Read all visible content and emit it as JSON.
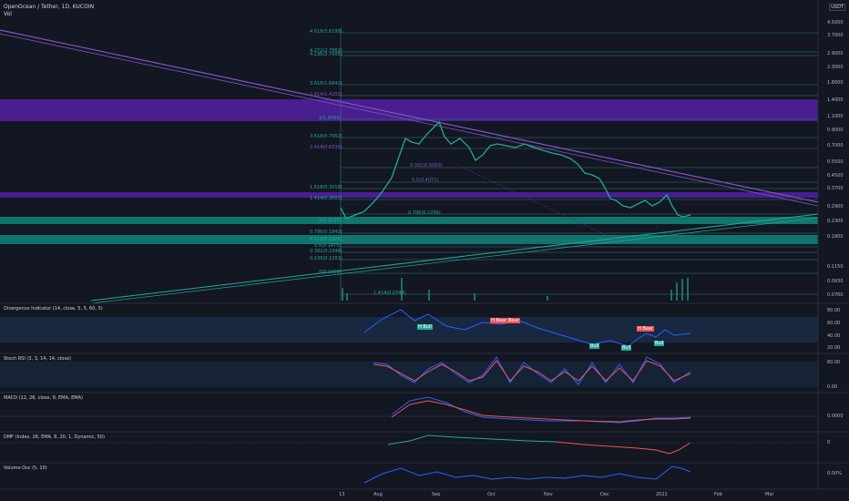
{
  "header": {
    "title": "OpenOcean / Tether, 1D, KUCOIN",
    "vol": "Vol",
    "currency": "USDT"
  },
  "price_axis": [
    "4.5000",
    "3.7000",
    "2.9000",
    "2.3000",
    "1.8000",
    "1.4000",
    "1.1000",
    "0.9000",
    "0.7000",
    "0.5500",
    "0.4500",
    "0.3700",
    "0.2900",
    "0.2300",
    "0.1800",
    "0.1150",
    "0.0930",
    "0.0760"
  ],
  "time_axis": [
    "13",
    "Aug",
    "Sep",
    "Oct",
    "Nov",
    "Dec",
    "2022",
    "Feb",
    "Mar"
  ],
  "fib_labels": [
    "4.618(3.6195)",
    "4.272(2.7862)",
    "4.236(2.7005)",
    "3.618(1.6642)",
    "2.414(1.4202)",
    "1(1.0096)",
    "3.618(0.7652)",
    "2.414(0.6530)",
    "0.382(0.5069)",
    "0.5(0.4071)",
    "1.618(0.3518)",
    "1.414(0.3002)",
    "0.786(0.2296)",
    "1(0.2135)",
    "0.786(0.1842)",
    "0.618(0.1666)",
    "0.5(0.1475)",
    "0.382(0.1348)",
    "0.236(0.1201)",
    "0(0.1039)",
    "1.414(0.0744)"
  ],
  "panels": {
    "divergence": {
      "title": "Divergence Indicator (14, close, 5, 5, 60, 5)",
      "ticks": [
        "80.00",
        "60.00",
        "40.00",
        "20.00"
      ]
    },
    "stoch": {
      "title": "Stoch RSI (3, 3, 14, 14, close)",
      "ticks": [
        "80.00",
        "0.00"
      ]
    },
    "macd": {
      "title": "MACD (12, 26, close, 9, EMA, EMA)",
      "ticks": [
        "0.0000"
      ]
    },
    "dmf": {
      "title": "DMF (Index, 26, EMA, 8, 20, 1, Dynamic, 50)",
      "ticks": [
        "0"
      ]
    },
    "volosc": {
      "title": "Volume Osc (5, 10)",
      "ticks": [
        "0.00%"
      ]
    }
  },
  "signals": [
    "H Bull",
    "H Bear",
    "Bear",
    "H Bear",
    "Bull",
    "Bull",
    "Bull"
  ],
  "colors": {
    "background": "#131722",
    "up": "#26a69a",
    "down": "#ef5350",
    "purple_zone": "#5b21b6",
    "teal_zone": "#0d9488",
    "rsi_line": "#2962ff"
  }
}
